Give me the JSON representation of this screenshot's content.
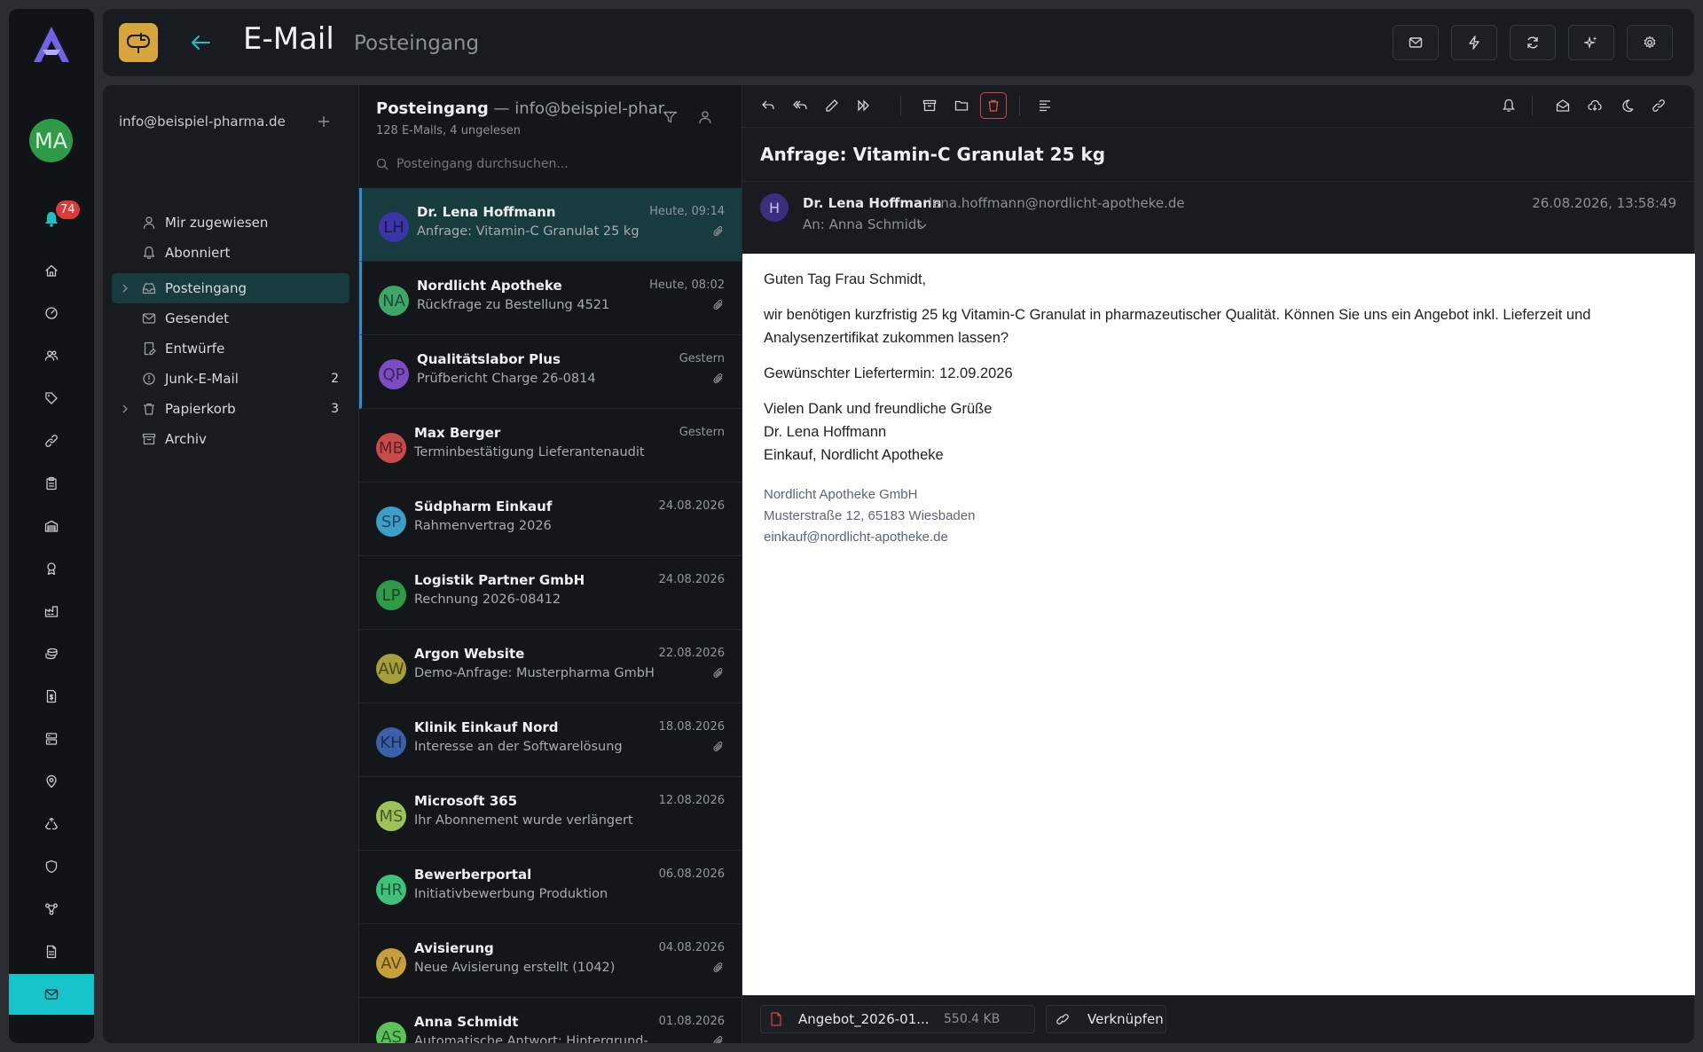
{
  "rail": {
    "avatar_initials": "MA",
    "notification_count": "74",
    "nav_icons": [
      "home-icon",
      "dashboard-icon",
      "users-icon",
      "tag-icon",
      "link-icon",
      "clipboard-icon",
      "warehouse-icon",
      "award-icon",
      "factory-icon",
      "coins-icon",
      "invoice-icon",
      "server-icon",
      "map-pin-icon",
      "recycle-icon",
      "shield-icon",
      "network-icon",
      "file-icon",
      "mail-icon"
    ],
    "active_icon": "mail-icon"
  },
  "header": {
    "title": "E-Mail",
    "subtitle": "Posteingang",
    "buttons": [
      "compose-mail",
      "quick-actions",
      "refresh",
      "ai-assistant",
      "settings"
    ]
  },
  "folders": {
    "account": "info@beispiel-pharma.de",
    "items": [
      {
        "label": "Mir zugewiesen",
        "icon": "user-icon",
        "count": ""
      },
      {
        "label": "Abonniert",
        "icon": "bell-icon",
        "count": ""
      },
      {
        "label": "Posteingang",
        "icon": "inbox-icon",
        "count": "",
        "active": true
      },
      {
        "label": "Gesendet",
        "icon": "mail-icon",
        "count": ""
      },
      {
        "label": "Entwürfe",
        "icon": "draft-icon",
        "count": ""
      },
      {
        "label": "Junk-E-Mail",
        "icon": "alert-icon",
        "count": "2"
      },
      {
        "label": "Papierkorb",
        "icon": "trash-icon",
        "count": "3"
      },
      {
        "label": "Archiv",
        "icon": "archive-icon",
        "count": ""
      }
    ]
  },
  "list": {
    "title": "Posteingang",
    "account_suffix": "— info@beispiel-phar...",
    "meta": "128 E-Mails, 4 ungelesen",
    "search_placeholder": "Posteingang durchsuchen...",
    "messages": [
      {
        "initials": "LH",
        "color": "#3b35a8",
        "sender": "Dr. Lena Hoffmann",
        "subject": "Anfrage: Vitamin-C Granulat 25 kg",
        "date": "Heute, 09:14",
        "attachment": true,
        "state": "selected"
      },
      {
        "initials": "NA",
        "color": "#3fa66a",
        "sender": "Nordlicht Apotheke",
        "subject": "Rückfrage zu Bestellung 4521",
        "date": "Heute, 08:02",
        "attachment": true,
        "state": "unread"
      },
      {
        "initials": "QP",
        "color": "#7c4cc4",
        "sender": "Qualitätslabor Plus",
        "subject": "Prüfbericht Charge 26-0814",
        "date": "Gestern",
        "attachment": true,
        "state": "unread"
      },
      {
        "initials": "MB",
        "color": "#c94a4a",
        "sender": "Max Berger",
        "subject": "Terminbestätigung Lieferantenaudit",
        "date": "Gestern",
        "attachment": false,
        "state": "read"
      },
      {
        "initials": "SP",
        "color": "#3d9ec8",
        "sender": "Südpharm Einkauf",
        "subject": "Rahmenvertrag 2026",
        "date": "24.08.2026",
        "attachment": false,
        "state": "read"
      },
      {
        "initials": "LP",
        "color": "#2f9a48",
        "sender": "Logistik Partner GmbH",
        "subject": "Rechnung 2026-08412",
        "date": "24.08.2026",
        "attachment": false,
        "state": "read"
      },
      {
        "initials": "AW",
        "color": "#a7a03a",
        "sender": "Argon Website",
        "subject": "Demo-Anfrage: Musterpharma GmbH",
        "date": "22.08.2026",
        "attachment": true,
        "state": "read"
      },
      {
        "initials": "KH",
        "color": "#3b5fa8",
        "sender": "Klinik Einkauf Nord",
        "subject": "Interesse an der Softwarelösung",
        "date": "18.08.2026",
        "attachment": true,
        "state": "read"
      },
      {
        "initials": "MS",
        "color": "#9ec25a",
        "sender": "Microsoft 365",
        "subject": "Ihr Abonnement wurde verlängert",
        "date": "12.08.2026",
        "attachment": false,
        "state": "read"
      },
      {
        "initials": "HR",
        "color": "#3fc37a",
        "sender": "Bewerberportal",
        "subject": "Initiativbewerbung Produktion",
        "date": "06.08.2026",
        "attachment": false,
        "state": "read"
      },
      {
        "initials": "AV",
        "color": "#c8a03a",
        "sender": "Avisierung",
        "subject": "Neue Avisierung erstellt (1042)",
        "date": "04.08.2026",
        "attachment": true,
        "state": "read"
      },
      {
        "initials": "AS",
        "color": "#5cc25a",
        "sender": "Anna Schmidt",
        "subject": "Automatische Antwort: Hintergrund-",
        "date": "01.08.2026",
        "attachment": true,
        "state": "read"
      }
    ]
  },
  "reader": {
    "subject": "Anfrage: Vitamin-C Granulat 25 kg",
    "sender_initial": "H",
    "from_name": "Dr. Lena Hoffmann",
    "from_email": "lena.hoffmann@nordlicht-apotheke.de",
    "to": "An: Anna Schmidt",
    "date": "26.08.2026, 13:58:49",
    "body": {
      "greeting": "Guten Tag Frau Schmidt,",
      "paragraph": "wir benötigen kurzfristig 25 kg Vitamin-C Granulat in pharmazeutischer Qualität. Können Sie uns ein Angebot inkl. Lieferzeit und Analysenzertifikat zukommen lassen?",
      "delivery": "Gewünschter Liefertermin: 12.09.2026",
      "closing": "Vielen Dank und freundliche Grüße",
      "name": "Dr. Lena Hoffmann",
      "role": "Einkauf, Nordlicht Apotheke",
      "sig_company": "Nordlicht Apotheke GmbH",
      "sig_address": "Musterstraße 12, 65183 Wiesbaden",
      "sig_email": "einkauf@nordlicht-apotheke.de"
    },
    "attachment_name": "Angebot_2026-01...",
    "attachment_size": "550.4 KB",
    "link_label": "Verknüpfen"
  },
  "colors": {
    "accent": "#15c3c9",
    "selected_bg": "#183c3e",
    "unread_marker": "#2a8fd4",
    "danger": "#d64545",
    "app_icon": "#d6a53b"
  }
}
